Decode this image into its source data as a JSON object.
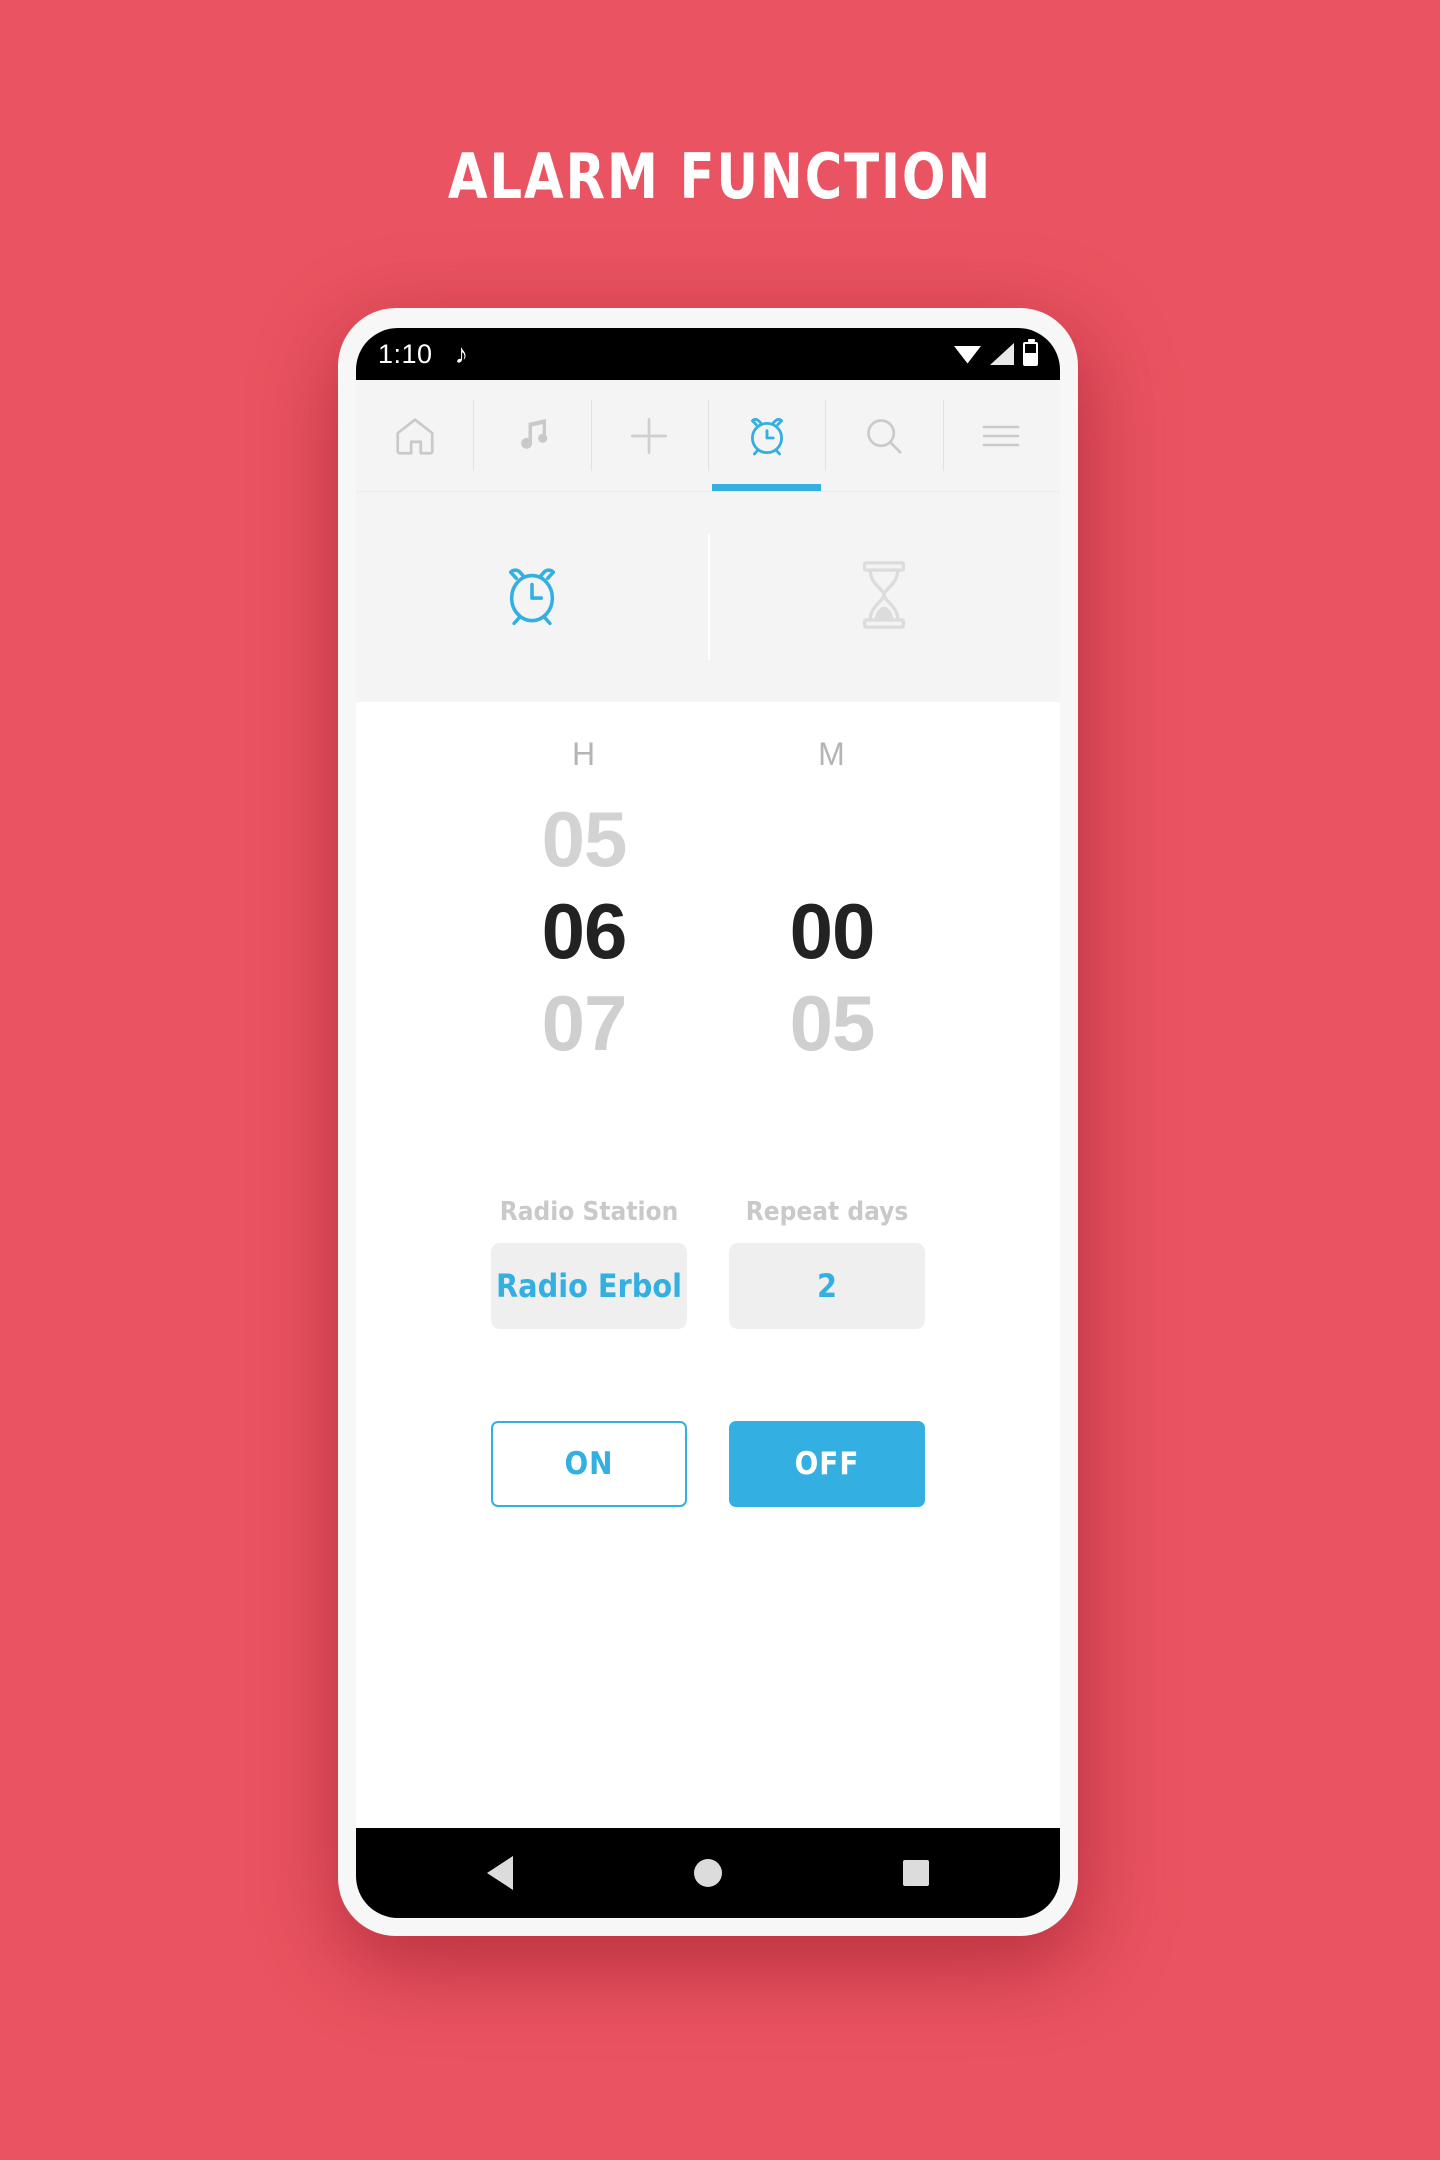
{
  "page": {
    "title": "ALARM FUNCTION",
    "background_color": "#ea5361",
    "accent_color": "#33afe2"
  },
  "statusbar": {
    "time": "1:10",
    "music_icon": "♪",
    "icons": [
      "wifi-icon",
      "signal-icon",
      "battery-icon"
    ]
  },
  "navbar": {
    "items": [
      {
        "name": "home-icon",
        "label": "Home",
        "active": false
      },
      {
        "name": "music-note-icon",
        "label": "Music",
        "active": false
      },
      {
        "name": "plus-icon",
        "label": "Add",
        "active": false
      },
      {
        "name": "alarm-clock-icon",
        "label": "Alarm",
        "active": true
      },
      {
        "name": "search-icon",
        "label": "Search",
        "active": false
      },
      {
        "name": "hamburger-menu-icon",
        "label": "Menu",
        "active": false
      }
    ]
  },
  "subtabs": [
    {
      "name": "alarm-clock-icon",
      "label": "Alarm",
      "active": true
    },
    {
      "name": "hourglass-icon",
      "label": "Timer",
      "active": false
    }
  ],
  "picker": {
    "hour_label": "H",
    "minute_label": "M",
    "hour": {
      "prev": "05",
      "selected": "06",
      "next": "07"
    },
    "minute": {
      "prev": "",
      "selected": "00",
      "next": "05"
    }
  },
  "fields": [
    {
      "label": "Radio Station",
      "value": "Radio Erbol"
    },
    {
      "label": "Repeat days",
      "value": "2"
    }
  ],
  "actions": {
    "on_label": "ON",
    "off_label": "OFF"
  },
  "sysnav": {
    "back": "back-triangle-icon",
    "home": "home-circle-icon",
    "recents": "recents-square-icon"
  }
}
